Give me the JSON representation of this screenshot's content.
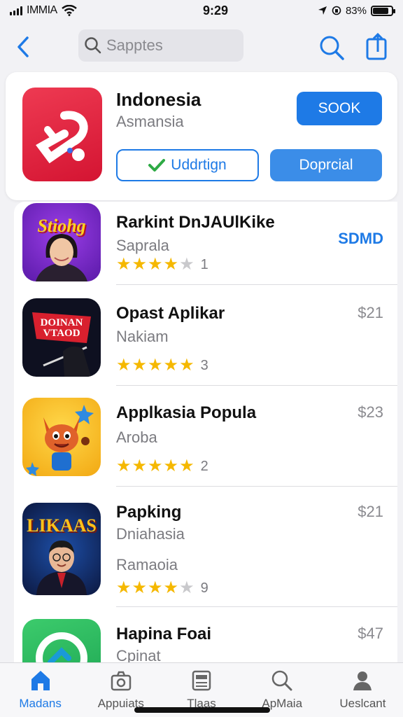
{
  "status_bar": {
    "carrier": "IMMIA",
    "time": "9:29",
    "battery": "83%",
    "battery_level": 0.83
  },
  "nav": {
    "search_placeholder": "Sapptes",
    "icons": [
      "chevron-left-icon",
      "search-icon",
      "share-icon"
    ]
  },
  "featured": {
    "name": "Indonesia",
    "subtitle": "Asmansia",
    "get_label": "SOOK",
    "update_label": "Uddrtign",
    "download_label": "Doprcial"
  },
  "apps": [
    {
      "name": "Rarkint DnJAUlKike",
      "subtitle": "Saprala",
      "price": "SDMD",
      "rating": 4,
      "rating_count": "1",
      "icon_text": "Stiohg"
    },
    {
      "name": "Opast Aplikar",
      "subtitle": "Nakiam",
      "price": "$21",
      "rating": 5,
      "rating_count": "3",
      "icon_text": "DOINAN VTAOD"
    },
    {
      "name": "Applkasia Popula",
      "subtitle": "Aroba",
      "price": "$23",
      "rating": 5,
      "rating_count": "2",
      "icon_text": ""
    },
    {
      "name": "Papking",
      "subtitle": "Dniahasia",
      "subtitle2": "Ramaoia",
      "price": "$21",
      "rating": 4,
      "rating_count": "9",
      "icon_text": "LIKAAS"
    },
    {
      "name": "Hapina Foai",
      "subtitle": "Cpinat",
      "price": "$47",
      "icon_text": ""
    }
  ],
  "tabs": [
    {
      "label": "Madans",
      "icon": "home-icon",
      "active": true
    },
    {
      "label": "Appuiats",
      "icon": "camera-icon",
      "active": false
    },
    {
      "label": "Tlaas",
      "icon": "news-icon",
      "active": false
    },
    {
      "label": "ApMaia",
      "icon": "search-icon",
      "active": false
    },
    {
      "label": "Ueslcant",
      "icon": "person-icon",
      "active": false
    }
  ],
  "colors": {
    "accent": "#1e7ae6",
    "star": "#f5b800"
  }
}
